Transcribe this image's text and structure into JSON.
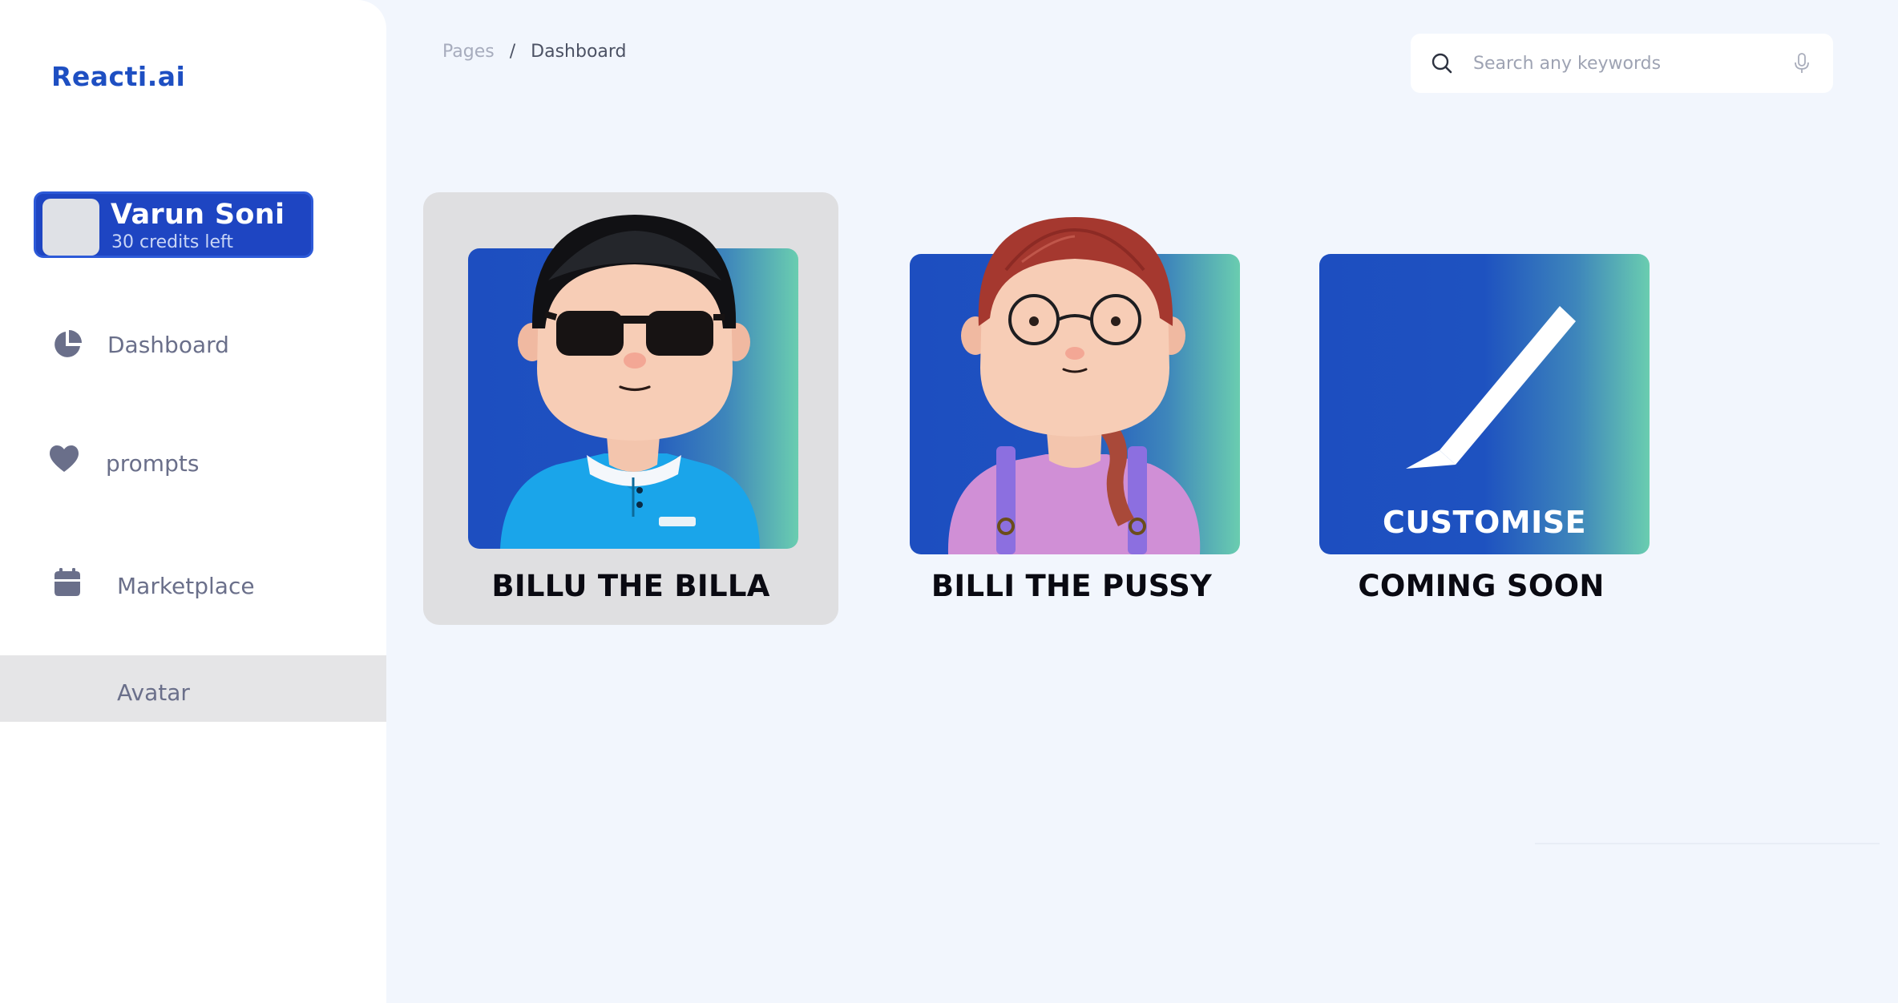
{
  "app": {
    "brand": "Reacti.ai"
  },
  "profile": {
    "name": "Varun Soni",
    "credits": "30 credits left"
  },
  "sidebar": {
    "items": [
      {
        "label": "Dashboard",
        "icon": "pie-chart-icon"
      },
      {
        "label": "prompts",
        "icon": "heart-icon"
      },
      {
        "label": "Marketplace",
        "icon": "calendar-icon"
      },
      {
        "label": "Avatar",
        "icon": "",
        "active": true
      }
    ]
  },
  "breadcrumb": {
    "parent": "Pages",
    "separator": "/",
    "current": "Dashboard"
  },
  "search": {
    "placeholder": "Search any keywords",
    "value": ""
  },
  "cards": [
    {
      "title": "BILLU THE BILLA",
      "selected": true
    },
    {
      "title": "BILLI THE PUSSY",
      "selected": false
    },
    {
      "title": "COMING SOON",
      "overlay": "CUSTOMISE",
      "selected": false
    }
  ],
  "colors": {
    "accent": "#1e45c2",
    "brand": "#1e4fc2",
    "background": "#f2f6fd",
    "gradient_start": "#1d4ec0",
    "gradient_end": "#6acdb0",
    "selected_card": "#dfdfe1"
  }
}
